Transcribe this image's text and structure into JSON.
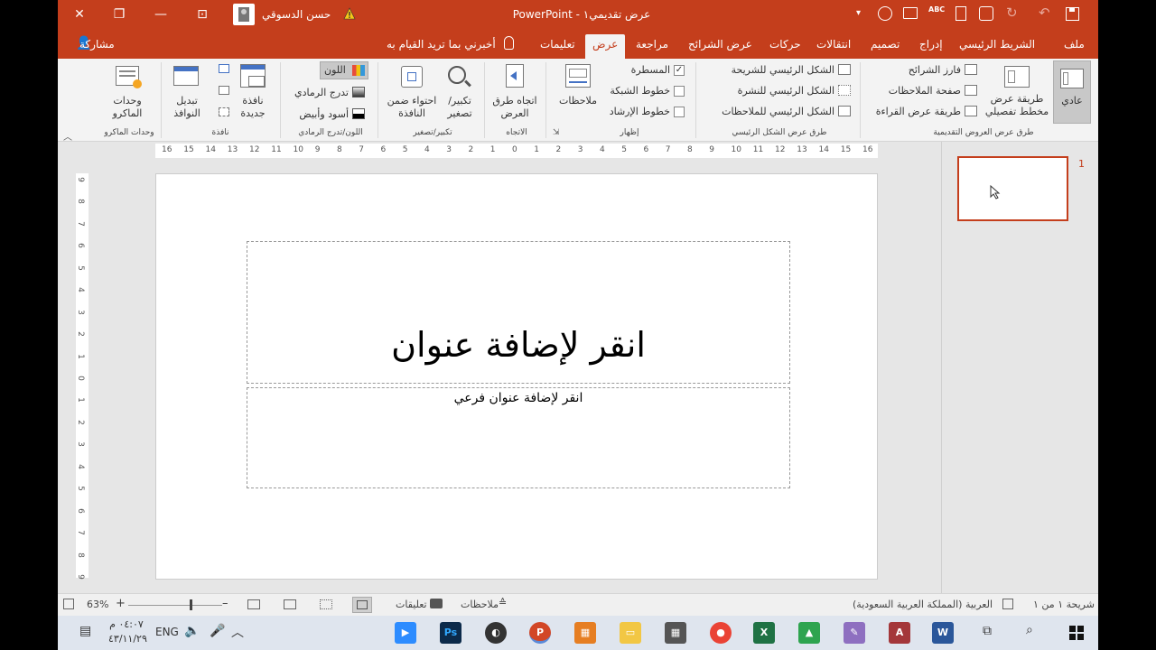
{
  "titlebar": {
    "title": "عرض تقديمي١ - PowerPoint",
    "user_name": "حسن الدسوقي",
    "close": "✕",
    "restore": "❐",
    "minimize": "—",
    "ribbon_display": "⊡"
  },
  "tabs": {
    "file": "ملف",
    "home": "الشريط الرئيسي",
    "insert": "إدراج",
    "design": "تصميم",
    "transitions": "انتقالات",
    "animations": "حركات",
    "slideshow": "عرض الشرائح",
    "review": "مراجعة",
    "view": "عرض",
    "help": "تعليمات",
    "tell_me": "أخبرني بما تريد القيام به",
    "share": "مشاركة"
  },
  "ribbon": {
    "normal": "عادي",
    "outline_view": "طريقة عرض مخطط تفصيلي",
    "slide_sorter": "فارز الشرائح",
    "notes_page": "صفحة الملاحظات",
    "reading_view": "طريقة عرض القراءة",
    "group_presentation_views": "طرق عرض العروض التقديمية",
    "slide_master": "الشكل الرئيسي للشريحة",
    "handout_master": "الشكل الرئيسي للنشرة",
    "notes_master": "الشكل الرئيسي للملاحظات",
    "group_master_views": "طرق عرض الشكل الرئيسي",
    "ruler": "المسطرة",
    "gridlines": "خطوط الشبكة",
    "guides": "خطوط الإرشاد",
    "group_show": "إظهار",
    "notes": "ملاحظات",
    "direction": "اتجاه طرق العرض",
    "group_direction": "الاتجاه",
    "zoom": "تكبير/ تصغير",
    "fit_window": "احتواء ضمن النافذة",
    "group_zoom": "تكبير/تصغير",
    "color": "اللون",
    "grayscale": "تدرج الرمادي",
    "black_white": "أسود وأبيض",
    "group_color": "اللون/تدرج الرمادي",
    "new_window": "نافذة جديدة",
    "switch_windows": "تبديل النوافذ",
    "group_window": "نافذة",
    "macros": "وحدات الماكرو",
    "group_macros": "وحدات الماكرو"
  },
  "ruler": {
    "h_ticks": [
      "16",
      "15",
      "14",
      "13",
      "12",
      "11",
      "10",
      "9",
      "8",
      "7",
      "6",
      "5",
      "4",
      "3",
      "2",
      "1",
      "0",
      "1",
      "2",
      "3",
      "4",
      "5",
      "6",
      "7",
      "8",
      "9",
      "10",
      "11",
      "12",
      "13",
      "14",
      "15",
      "16"
    ],
    "v_ticks": [
      "9",
      "8",
      "7",
      "6",
      "5",
      "4",
      "3",
      "2",
      "1",
      "0",
      "1",
      "2",
      "3",
      "4",
      "5",
      "6",
      "7",
      "8",
      "9"
    ]
  },
  "slide": {
    "title_placeholder": "انقر لإضافة عنوان",
    "subtitle_placeholder": "انقر لإضافة عنوان فرعي"
  },
  "thumbs": {
    "number": "1"
  },
  "status": {
    "slide_info": "شريحة ١ من ١",
    "language": "العربية (المملكة العربية السعودية)",
    "notes": "ملاحظات",
    "comments": "تعليقات",
    "zoom": "63%",
    "plus": "+",
    "minus": "–"
  },
  "taskbar": {
    "time": "٠٤:٠٧ م",
    "date": "٤٣/١١/٢٩",
    "lang": "ENG"
  },
  "colors": {
    "accent": "#c43e1c",
    "ribbon_bg": "#f3f3f3"
  }
}
